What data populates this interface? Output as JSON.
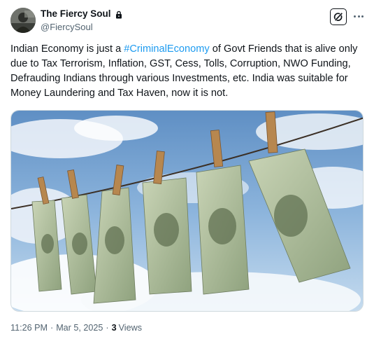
{
  "author": {
    "display_name": "The Fiercy Soul",
    "handle": "@FiercySoul",
    "badge_icon": "lock-icon"
  },
  "actions": {
    "grok_icon": "grok-icon",
    "more_icon": "more-icon"
  },
  "tweet": {
    "text_before": "Indian Economy is just a ",
    "hashtag": "#CriminalEconomy",
    "text_after": " of Govt Friends that is alive only due to Tax Terrorism, Inflation, GST, Cess, Tolls, Corruption, NWO Funding, Defrauding Indians through various Investments, etc. India was suitable for Money Laundering and Tax Haven, now it is not."
  },
  "media": {
    "kind": "photo"
  },
  "meta": {
    "time": "11:26 PM",
    "dot1": "·",
    "date": "Mar 5, 2025",
    "dot2": "·",
    "views_count": "3",
    "views_label": "Views"
  },
  "colors": {
    "link": "#1d9bf0",
    "text": "#0f1419",
    "secondary": "#536471",
    "border": "#cfd9de"
  }
}
